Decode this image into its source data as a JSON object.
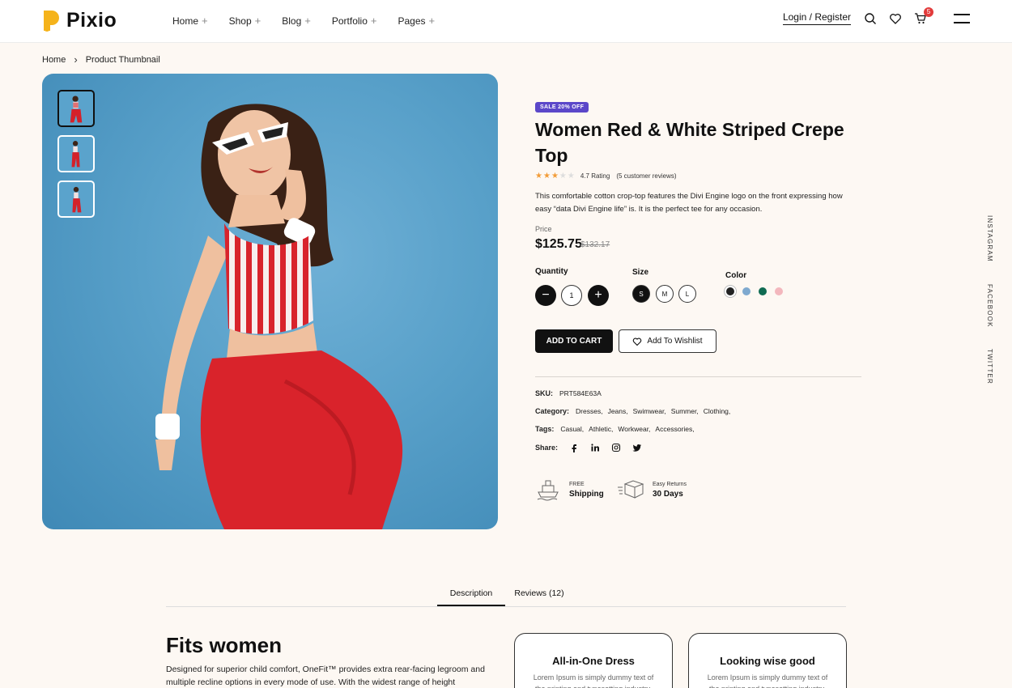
{
  "header": {
    "logo_text": "Pixio",
    "nav": [
      {
        "label": "Home"
      },
      {
        "label": "Shop"
      },
      {
        "label": "Blog"
      },
      {
        "label": "Portfolio"
      },
      {
        "label": "Pages"
      }
    ],
    "nav_plus": "+",
    "login_label": "Login / Register",
    "cart_count": "5",
    "brand_color": "#f5b31b"
  },
  "breadcrumb": {
    "home": "Home",
    "separator": "›",
    "current": "Product Thumbnail"
  },
  "product": {
    "sale_badge": "SALE 20% OFF",
    "title": "Women Red & White Striped Crepe Top",
    "stars": "★★★★★",
    "rating_text": "4.7 Rating",
    "reviews_text": "(5 customer reviews)",
    "description": "This comfortable cotton crop-top features the Divi Engine logo on the front expressing how easy “data Divi Engine life” is. It is the perfect tee for any occasion.",
    "price_label": "Price",
    "price": "$125.75",
    "price_old": "$132.17",
    "quantity_label": "Quantity",
    "quantity_minus": "−",
    "quantity_value": "1",
    "quantity_plus": "+",
    "size_label": "Size",
    "sizes": [
      "S",
      "M",
      "L"
    ],
    "color_label": "Color",
    "colors": [
      "#222222",
      "#7fa9cf",
      "#0f6b52",
      "#f3b7bd"
    ],
    "add_to_cart": "ADD TO CART",
    "add_to_wishlist": "Add To Wishlist",
    "sku_label": "SKU:",
    "sku_value": "PRT584E63A",
    "category_label": "Category:",
    "categories": [
      "Dresses,",
      "Jeans,",
      "Swimwear,",
      "Summer,",
      "Clothing,"
    ],
    "tags_label": "Tags:",
    "tags": [
      "Casual,",
      "Athletic,",
      "Workwear,",
      "Accessories,"
    ],
    "share_label": "Share:",
    "share_icons": [
      "facebook-icon",
      "linkedin-icon",
      "instagram-icon",
      "twitter-icon"
    ],
    "features": [
      {
        "small": "FREE",
        "big": "Shipping"
      },
      {
        "small": "Easy Returns",
        "big": "30 Days"
      }
    ]
  },
  "social_vertical": [
    "INSTAGRAM",
    "FACEBOOK",
    "TWITTER"
  ],
  "tabs": [
    {
      "label": "Description"
    },
    {
      "label": "Reviews (12)"
    }
  ],
  "description_section": {
    "title": "Fits women",
    "text": "Designed for superior child comfort, OneFit™ provides extra rear-facing legroom and multiple recline options in every mode of use. With the widest range of height",
    "cards": [
      {
        "title": "All-in-One Dress",
        "text": "Lorem Ipsum is simply dummy text of the printing and typesetting industry."
      },
      {
        "title": "Looking wise good",
        "text": "Lorem Ipsum is simply dummy text of the printing and typesetting industry."
      }
    ]
  }
}
